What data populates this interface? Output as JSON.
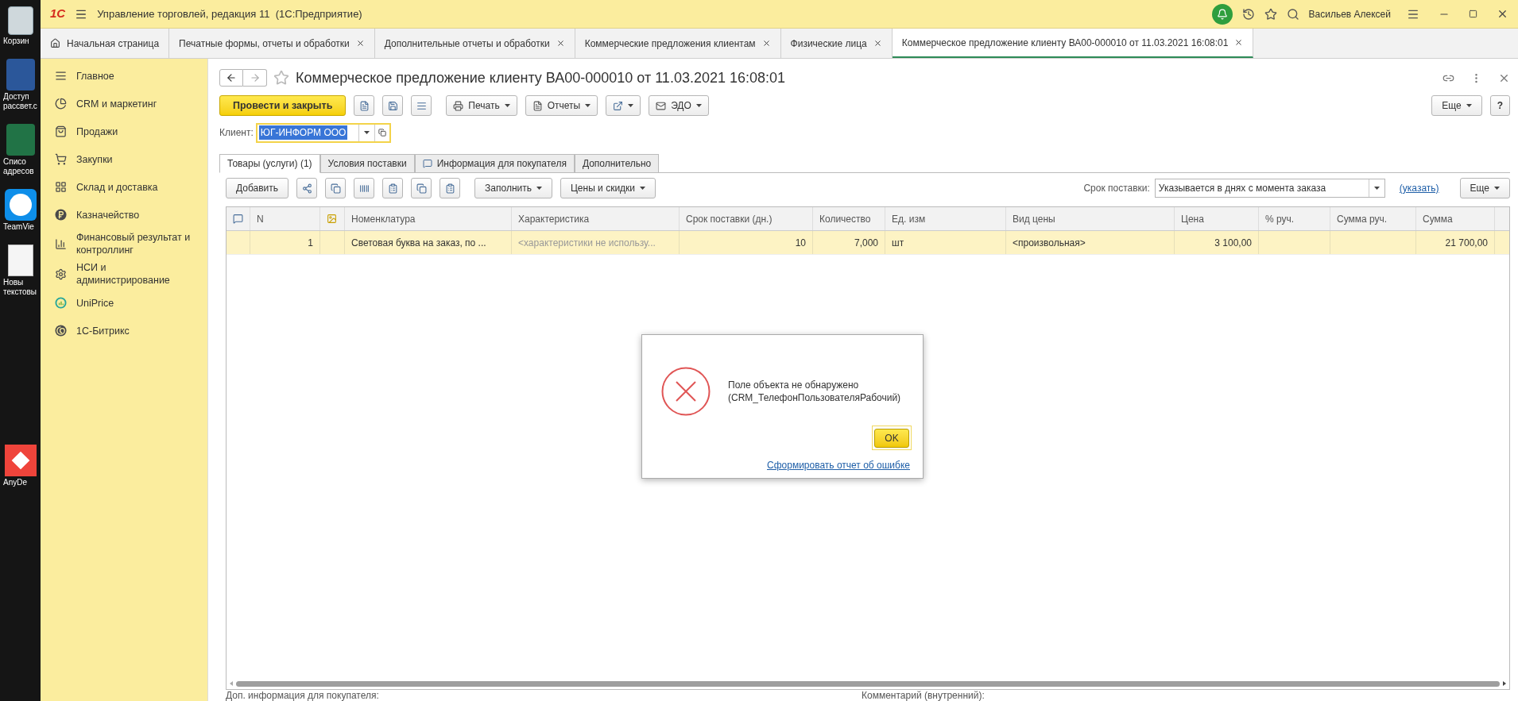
{
  "desktop": {
    "icons": [
      {
        "kind": "recycle",
        "label": "Корзин"
      },
      {
        "kind": "word",
        "label": "Доступ\nрассвет.с"
      },
      {
        "kind": "excel",
        "label": "Списо\nадресов"
      },
      {
        "kind": "teamviewer",
        "label": "TeamVie"
      },
      {
        "kind": "text",
        "label": "Новы\nтекстовы"
      },
      {
        "kind": "anydesk",
        "label": "AnyDe"
      }
    ]
  },
  "window": {
    "logo": "1С",
    "title": "Управление торговлей, редакция 11  (1С:Предприятие)",
    "user": "Васильев Алексей"
  },
  "tabs": [
    {
      "label": "Начальная страница",
      "kind": "home",
      "selected": false
    },
    {
      "label": "Печатные формы, отчеты и обработки",
      "kind": "tab",
      "selected": false
    },
    {
      "label": "Дополнительные отчеты и обработки",
      "kind": "tab",
      "selected": false
    },
    {
      "label": "Коммерческие предложения клиентам",
      "kind": "tab",
      "selected": false
    },
    {
      "label": "Физические лица",
      "kind": "tab",
      "selected": false
    },
    {
      "label": "Коммерческое предложение клиенту ВА00-000010 от 11.03.2021 16:08:01",
      "kind": "tab",
      "selected": true
    }
  ],
  "sidebar": {
    "items": [
      {
        "label": "Главное"
      },
      {
        "label": "CRM и маркетинг"
      },
      {
        "label": "Продажи"
      },
      {
        "label": "Закупки"
      },
      {
        "label": "Склад и доставка"
      },
      {
        "label": "Казначейство"
      },
      {
        "label": "Финансовый результат и контроллинг"
      },
      {
        "label": "НСИ и администрирование"
      },
      {
        "label": "UniPrice"
      },
      {
        "label": "1С-Битрикс"
      }
    ]
  },
  "form": {
    "title": "Коммерческое предложение клиенту ВА00-000010 от 11.03.2021 16:08:01",
    "toolbar": {
      "primary": "Провести и закрыть",
      "print": "Печать",
      "reports": "Отчеты",
      "edo": "ЭДО",
      "more": "Еще",
      "help": "?"
    },
    "client": {
      "label": "Клиент:",
      "value": "ЮГ-ИНФОРМ ООО"
    },
    "tabs": [
      {
        "label": "Товары (услуги) (1)",
        "selected": true
      },
      {
        "label": "Условия поставки",
        "selected": false
      },
      {
        "label": "Информация для покупателя",
        "selected": false
      },
      {
        "label": "Дополнительно",
        "selected": false
      }
    ],
    "table_toolbar": {
      "add": "Добавить",
      "fill": "Заполнить",
      "prices": "Цены и скидки",
      "term_label": "Срок поставки:",
      "term_value": "Указывается в днях с момента заказа",
      "term_link": "(указать)",
      "more": "Еще"
    },
    "table": {
      "columns": [
        {
          "kind": "icon"
        },
        {
          "kind": "text",
          "label": "N"
        },
        {
          "kind": "icon"
        },
        {
          "kind": "text",
          "label": "Номенклатура"
        },
        {
          "kind": "text",
          "label": "Характеристика"
        },
        {
          "kind": "text",
          "label": "Срок поставки (дн.)"
        },
        {
          "kind": "text",
          "label": "Количество"
        },
        {
          "kind": "text",
          "label": "Ед. изм"
        },
        {
          "kind": "text",
          "label": "Вид цены"
        },
        {
          "kind": "text",
          "label": "Цена"
        },
        {
          "kind": "text",
          "label": "% руч."
        },
        {
          "kind": "text",
          "label": "Сумма руч."
        },
        {
          "kind": "text",
          "label": "Сумма"
        }
      ],
      "rows": [
        {
          "selected": true,
          "n": "1",
          "item": "Световая буква на заказ, по ...",
          "characteristic": "<характеристики не использу...",
          "lead_time": "10",
          "quantity": "7,000",
          "unit": "шт",
          "price_type": "<произвольная>",
          "price": "3 100,00",
          "amount": "21 700,00"
        }
      ]
    },
    "footer": {
      "buyer_info": "Доп. информация для покупателя:",
      "comment": "Комментарий (внутренний):"
    }
  },
  "dialog": {
    "message": "Поле объекта не обнаружено\n(CRM_ТелефонПользователяРабочий)",
    "ok": "OK",
    "link": "Сформировать отчет об ошибке"
  }
}
